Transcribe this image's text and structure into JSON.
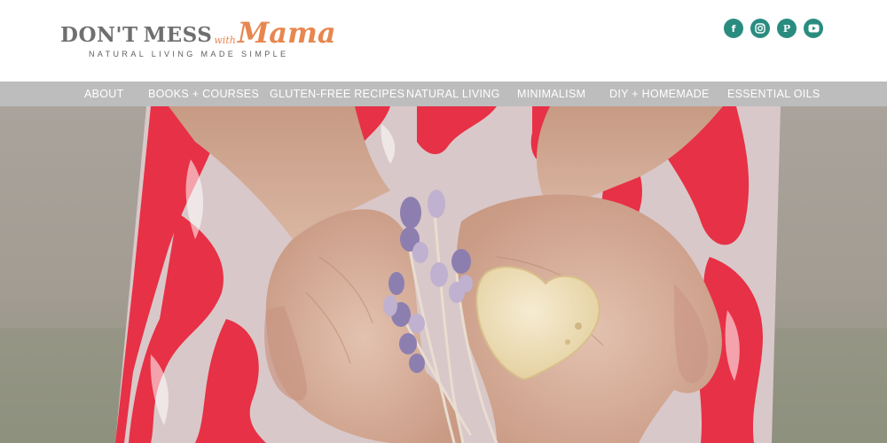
{
  "logo": {
    "word_dont": "DON'T",
    "word_mess": "MESS",
    "word_with": "with",
    "word_mama": "Mama",
    "tagline": "NATURAL LIVING MADE SIMPLE"
  },
  "social": [
    {
      "icon": "facebook-icon",
      "glyph": "f"
    },
    {
      "icon": "instagram-icon",
      "glyph": ""
    },
    {
      "icon": "pinterest-icon",
      "glyph": "P"
    },
    {
      "icon": "youtube-icon",
      "glyph": ""
    }
  ],
  "nav": {
    "items": [
      {
        "label": "ABOUT"
      },
      {
        "label": "BOOKS + COURSES"
      },
      {
        "label": "GLUTEN-FREE RECIPES"
      },
      {
        "label": "NATURAL LIVING"
      },
      {
        "label": "MINIMALISM"
      },
      {
        "label": "DIY + HOMEMADE"
      },
      {
        "label": "ESSENTIAL OILS"
      }
    ]
  },
  "colors": {
    "brand_gray": "#6f6f6f",
    "brand_orange": "#e7874f",
    "social_teal": "#2a8c7f",
    "nav_bg": "#bdbdbd"
  }
}
